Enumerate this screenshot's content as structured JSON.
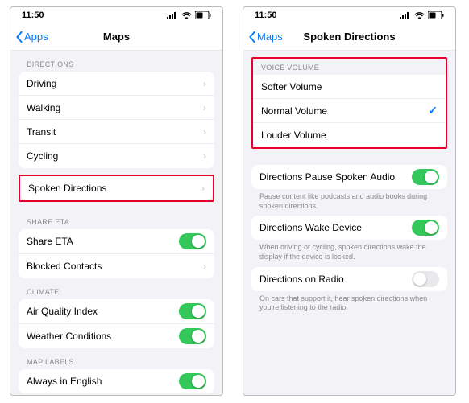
{
  "status": {
    "time": "11:50"
  },
  "left": {
    "back": "Apps",
    "title": "Maps",
    "sections": {
      "directions_h": "DIRECTIONS",
      "driving": "Driving",
      "walking": "Walking",
      "transit": "Transit",
      "cycling": "Cycling",
      "spoken": "Spoken Directions",
      "share_h": "SHARE ETA",
      "share_eta": "Share ETA",
      "blocked": "Blocked Contacts",
      "climate_h": "CLIMATE",
      "aqi": "Air Quality Index",
      "weather": "Weather Conditions",
      "maplabels_h": "MAP LABELS",
      "always_en": "Always in English"
    }
  },
  "right": {
    "back": "Maps",
    "title": "Spoken Directions",
    "voice_h": "VOICE VOLUME",
    "softer": "Softer Volume",
    "normal": "Normal Volume",
    "louder": "Louder Volume",
    "pause": "Directions Pause Spoken Audio",
    "pause_foot": "Pause content like podcasts and audio books during spoken directions.",
    "wake": "Directions Wake Device",
    "wake_foot": "When driving or cycling, spoken directions wake the display if the device is locked.",
    "radio": "Directions on Radio",
    "radio_foot": "On cars that support it, hear spoken directions when you're listening to the radio."
  }
}
